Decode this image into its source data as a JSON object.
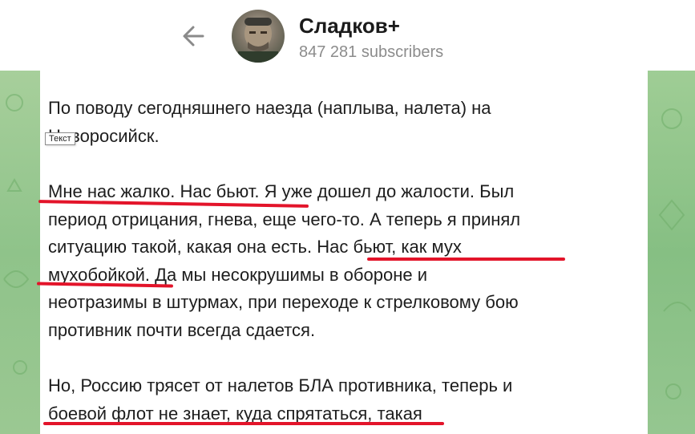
{
  "header": {
    "channel_name": "Сладков+",
    "subscribers": "847 281 subscribers"
  },
  "message": {
    "p1": "По поводу сегодняшнего наезда (наплыва, налета) на\nНоворосийск.",
    "p2": "Мне нас жалко. Нас бьют. Я уже дошел до жалости. Был\nпериод отрицания, гнева, еще чего-то. А теперь я принял\nситуацию такой, какая она есть. Нас бьют, как мух\nмухобойкой. Да мы несокрушимы в обороне и\nнеотразимы в штурмах, при переходе к стрелковому бою\nпротивник почти всегда сдается.",
    "p3": "Но, Россию трясет от налетов БЛА противника, теперь и\nбоевой флот не знает, куда спрятаться, такая"
  },
  "tooltip": "Текст",
  "colors": {
    "underline": "#e3142a",
    "wallpaper": "#8fc38a"
  },
  "icons": {
    "back": "back-arrow-icon",
    "avatar": "avatar"
  }
}
